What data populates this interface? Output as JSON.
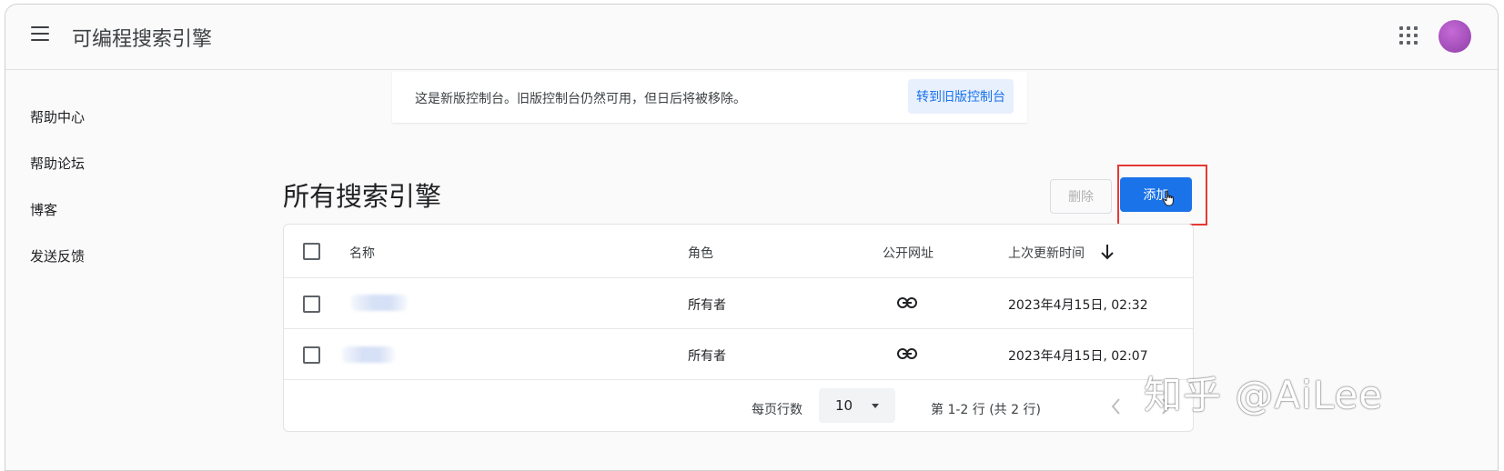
{
  "header": {
    "menu_icon": "hamburger-menu-icon",
    "app_title": "可编程搜索引擎",
    "apps_icon": "apps-grid-icon",
    "avatar_color": "#9c4dbf"
  },
  "sidebar": {
    "items": [
      {
        "label": "帮助中心"
      },
      {
        "label": "帮助论坛"
      },
      {
        "label": "博客"
      },
      {
        "label": "发送反馈"
      }
    ]
  },
  "banner": {
    "message": "这是新版控制台。旧版控制台仍然可用，但日后将被移除。",
    "action_label": "转到旧版控制台"
  },
  "main": {
    "title": "所有搜索引擎",
    "delete_label": "删除",
    "add_label": "添加"
  },
  "table": {
    "columns": {
      "name": "名称",
      "role": "角色",
      "public_url": "公开网址",
      "updated": "上次更新时间"
    },
    "sort_icon": "arrow-down-icon",
    "rows": [
      {
        "name": "",
        "role": "所有者",
        "url_icon": "link-icon",
        "updated": "2023年4月15日, 02:32"
      },
      {
        "name": "",
        "role": "所有者",
        "url_icon": "link-icon",
        "updated": "2023年4月15日, 02:07"
      }
    ],
    "footer": {
      "rows_per_page_label": "每页行数",
      "rows_per_page_value": "10",
      "range_text": "第 1-2 行 (共 2 行)"
    }
  },
  "colors": {
    "primary": "#1a73e8",
    "highlight_border": "#e53935"
  },
  "watermark": "知乎 @AiLee"
}
